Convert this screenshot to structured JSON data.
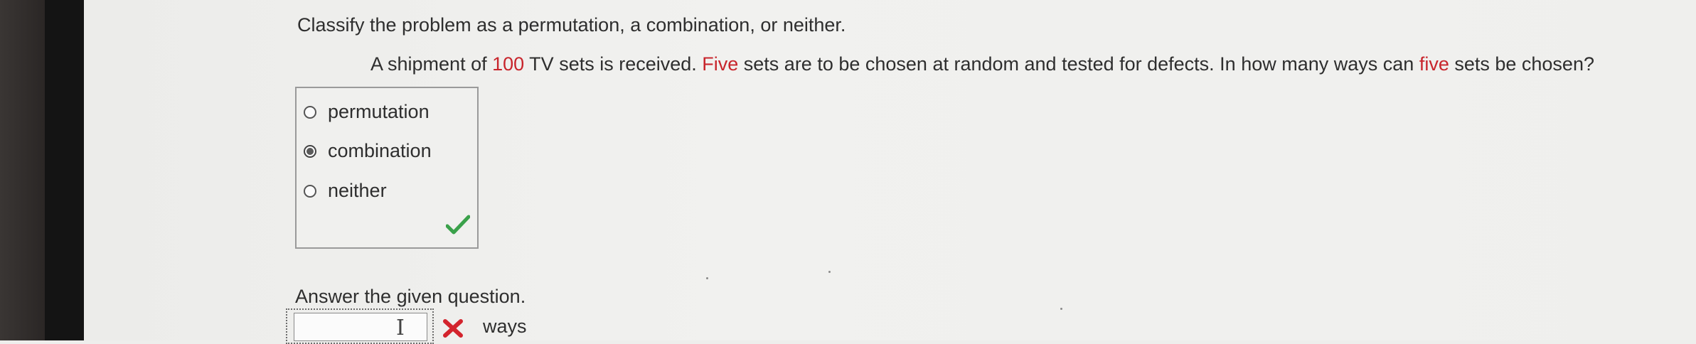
{
  "instruction": "Classify the problem as a permutation, a combination, or neither.",
  "question": {
    "part1": "A shipment of ",
    "num_sets": "100",
    "part2": " TV sets is received. ",
    "five1": "Five",
    "part3": " sets are to be chosen at random and tested for defects. In how many ways can ",
    "five2": "five",
    "part4": " sets be chosen?"
  },
  "choices": [
    {
      "label": "permutation",
      "selected": false
    },
    {
      "label": "combination",
      "selected": true
    },
    {
      "label": "neither",
      "selected": false
    }
  ],
  "choice_feedback": "check-icon",
  "answer": {
    "prompt": "Answer the given question.",
    "value": "",
    "units": "ways",
    "feedback": "x-icon"
  },
  "colors": {
    "highlight": "#c8252c",
    "correct": "#3aa14a",
    "incorrect": "#d3242d"
  }
}
